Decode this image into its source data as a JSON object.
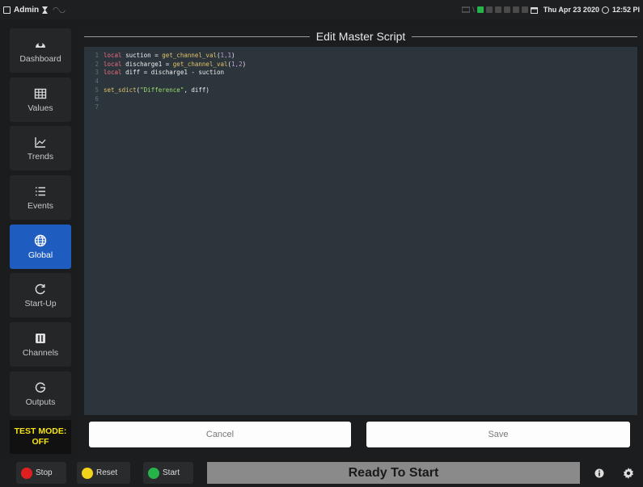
{
  "topbar": {
    "user": "Admin",
    "datetime": "Thu Apr 23 2020",
    "time": "12:52 PI",
    "indicators": [
      "on",
      "dim",
      "dim",
      "dim",
      "dim",
      "dim"
    ]
  },
  "sidebar": {
    "items": [
      {
        "label": "Dashboard",
        "icon": "dashboard-icon"
      },
      {
        "label": "Values",
        "icon": "grid-icon"
      },
      {
        "label": "Trends",
        "icon": "chart-icon"
      },
      {
        "label": "Events",
        "icon": "list-icon"
      },
      {
        "label": "Global",
        "icon": "globe-icon",
        "active": true
      },
      {
        "label": "Start-Up",
        "icon": "refresh-icon"
      },
      {
        "label": "Channels",
        "icon": "channels-icon"
      },
      {
        "label": "Outputs",
        "icon": "output-icon"
      }
    ],
    "test_mode_line1": "TEST MODE:",
    "test_mode_line2": "OFF"
  },
  "editor": {
    "title": "Edit Master Script",
    "lines": [
      {
        "num": "1",
        "kw": "local",
        "rest1": " suction = ",
        "fn": "get_channel_val",
        "rest2": "(",
        "args": "1,1",
        "rest3": ")"
      },
      {
        "num": "2",
        "kw": "local",
        "rest1": " discharge1 = ",
        "fn": "get_channel_val",
        "rest2": "(",
        "args": "1,2",
        "rest3": ")"
      },
      {
        "num": "3",
        "kw": "local",
        "rest1": " diff = discharge1 - suction",
        "fn": "",
        "rest2": "",
        "args": "",
        "rest3": ""
      },
      {
        "num": "4",
        "kw": "",
        "rest1": "",
        "fn": "",
        "rest2": "",
        "args": "",
        "rest3": ""
      },
      {
        "num": "5",
        "kw": "",
        "rest1": "",
        "fn": "set_sdict",
        "rest2": "(",
        "str": "\"Difference\"",
        "rest3": ", diff)"
      },
      {
        "num": "6",
        "kw": "",
        "rest1": "",
        "fn": "",
        "rest2": "",
        "args": "",
        "rest3": ""
      },
      {
        "num": "7",
        "kw": "",
        "rest1": "",
        "fn": "",
        "rest2": "",
        "args": "",
        "rest3": ""
      }
    ],
    "cancel_label": "Cancel",
    "save_label": "Save"
  },
  "bottom": {
    "stop_label": "Stop",
    "reset_label": "Reset",
    "start_label": "Start",
    "status": "Ready To Start"
  },
  "colors": {
    "accent": "#1f5cc0",
    "stop": "#e02020",
    "reset": "#f2d21a",
    "start": "#25b34a",
    "test_mode": "#f5e417"
  }
}
